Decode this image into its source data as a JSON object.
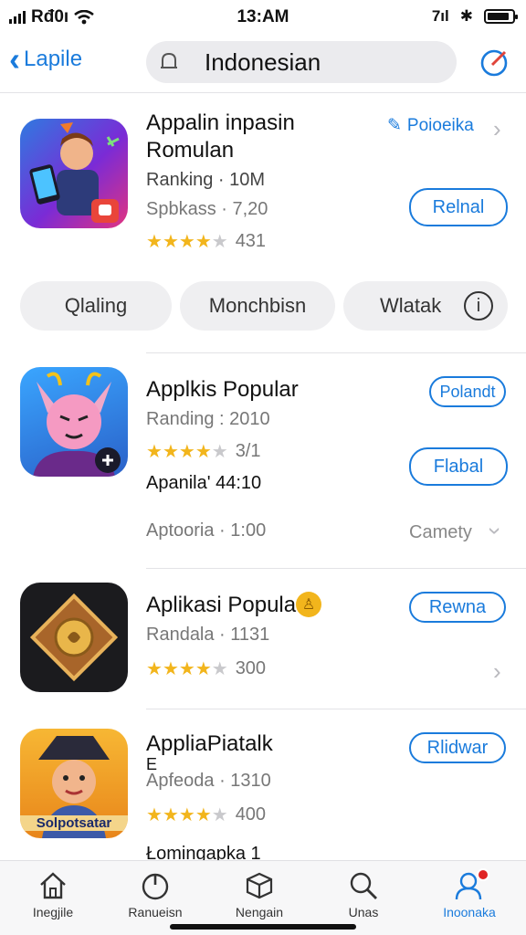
{
  "status_bar": {
    "carrier": "Rđ0ı",
    "time": "13:AM",
    "right_text": "7ıl"
  },
  "nav": {
    "back_label": "Lapile",
    "search_text": "Indonesian"
  },
  "apps": [
    {
      "title_line1": "Appalin inpasin",
      "title_line2": "Romulan",
      "meta1": "Ranking  · 10M",
      "meta2": "Spbkass  · 7,20",
      "rating": 4,
      "rating_text": "431",
      "tag_label": "Poioeika",
      "button_label": "Relnal"
    },
    {
      "title": "Applkis Popular",
      "meta1": "Randing  : 2010",
      "rating": 3.5,
      "rating_text": "3/1",
      "tag_label": "Polandt",
      "button_label": "Flabal",
      "extra": "Apanila' 44:10",
      "footer_left": "Aptooria  · 1:00",
      "footer_right": "Camety"
    },
    {
      "title": "Aplikasi Popula",
      "meta1": "Randala  · 1131",
      "rating": 4,
      "rating_text": "300",
      "button_label": "Rewna"
    },
    {
      "title_line1": "AppliaPiatalk",
      "title_line2": "E",
      "meta1": "Apfeoda  · 1310",
      "rating": 4,
      "rating_text": "400",
      "button_label": "Rlidwar",
      "footer_left": "Łomingapka  1",
      "icon_caption": "Solpotsatar"
    }
  ],
  "segments": [
    "Qlaling",
    "Monchbisn",
    "Wlatak"
  ],
  "tabs": [
    {
      "label": "Inegjile",
      "icon": "home-icon"
    },
    {
      "label": "Ranueisn",
      "icon": "power-icon"
    },
    {
      "label": "Nengain",
      "icon": "box-icon"
    },
    {
      "label": "Unas",
      "icon": "search-icon"
    },
    {
      "label": "Inoonaka",
      "icon": "people-icon"
    }
  ],
  "colors": {
    "accent": "#1a7bdc",
    "star": "#f2b51c",
    "badge": "#e02424"
  }
}
